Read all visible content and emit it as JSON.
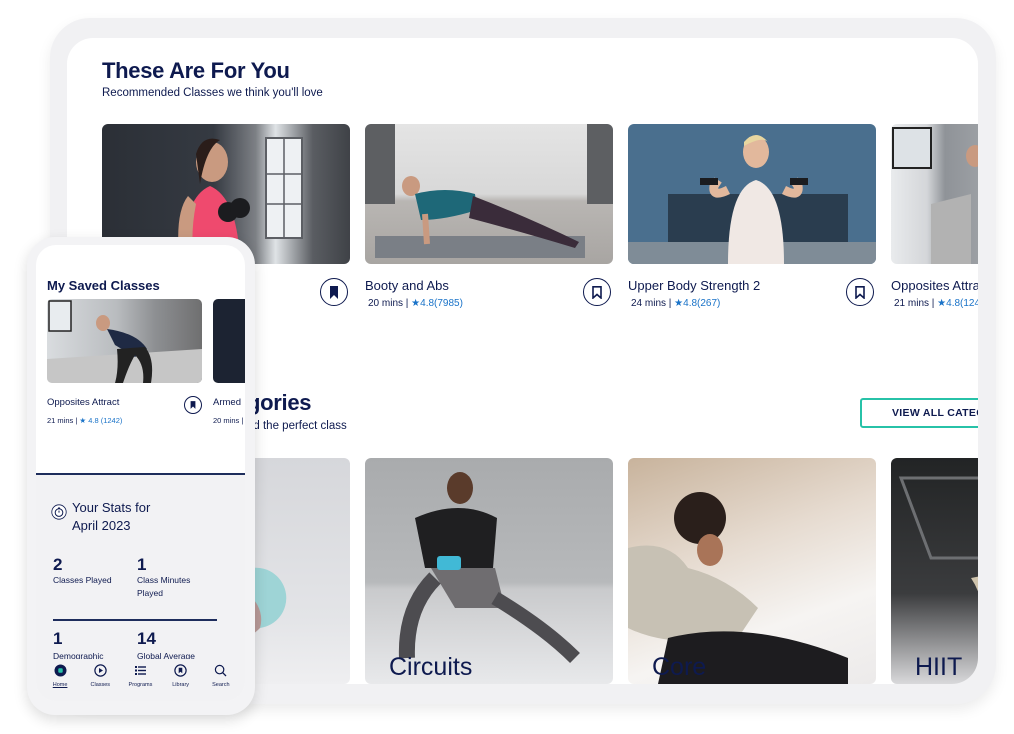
{
  "tablet": {
    "recommended": {
      "title": "These Are For You",
      "subtitle": "Recommended Classes we think you'll love",
      "cards": [
        {
          "title": "",
          "duration": "",
          "rating": "",
          "image": "woman-red-tank-dumbbell"
        },
        {
          "title": "Booty and Abs",
          "duration": "20 mins |",
          "rating": "★4.8(7985)",
          "image": "woman-side-plank"
        },
        {
          "title": "Upper Body Strength 2",
          "duration": "24 mins |",
          "rating": "★4.8(267)",
          "image": "woman-bicep-curl"
        },
        {
          "title": "Opposites Attra",
          "duration": "21 mins |",
          "rating": "★4.8(124",
          "image": "woman-bent-row"
        }
      ]
    },
    "categories": {
      "title_partial": "gories",
      "subtitle_partial": "nd the perfect class",
      "view_all_label": "VIEW ALL CATEGORIES",
      "items": [
        {
          "label": "",
          "image": "gray-wall-ball"
        },
        {
          "label": "Circuits",
          "image": "man-side-lunge"
        },
        {
          "label": "Core",
          "image": "woman-situp-outdoor"
        },
        {
          "label": "HIIT",
          "image": "gym-treadmill"
        }
      ]
    }
  },
  "phone": {
    "saved": {
      "title": "My Saved Classes",
      "cards": [
        {
          "title": "Opposites Attract",
          "duration": "21 mins |",
          "rating": "★ 4.8 (1242)"
        },
        {
          "title": "Armed",
          "duration": "20 mins |",
          "rating": ""
        }
      ]
    },
    "stats": {
      "title_line1": "Your Stats for",
      "title_line2": "April 2023",
      "items": [
        {
          "value": "2",
          "label": "Classes Played"
        },
        {
          "value": "1",
          "label": "Class Minutes Played"
        },
        {
          "value": "1",
          "label": "Demographic"
        },
        {
          "value": "14",
          "label": "Global Average"
        }
      ]
    },
    "nav": [
      {
        "label": "Home",
        "icon": "home-icon",
        "active": true
      },
      {
        "label": "Classes",
        "icon": "play-circle-icon"
      },
      {
        "label": "Programs",
        "icon": "list-icon"
      },
      {
        "label": "Library",
        "icon": "bookmark-circle-icon"
      },
      {
        "label": "Search",
        "icon": "search-icon"
      }
    ]
  },
  "colors": {
    "navy": "#0e1a4f",
    "rating_blue": "#1a73c8",
    "accent_teal": "#27c2a8"
  }
}
